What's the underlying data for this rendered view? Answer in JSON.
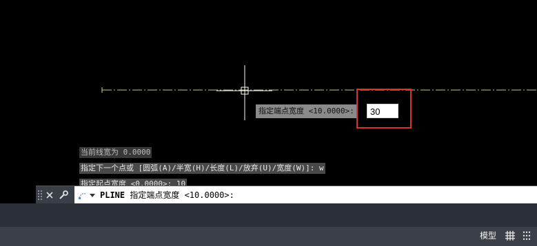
{
  "dynamic_input": {
    "prompt": "指定端点宽度 <10.0000>:",
    "value": "30"
  },
  "history": [
    "当前线宽为 0.0000",
    "指定下一个点或 [圆弧(A)/半宽(H)/长度(L)/放弃(U)/宽度(W)]: w",
    "指定起点宽度 <0.0000>: 10"
  ],
  "command_line": {
    "command": "PLINE",
    "prompt": " 指定端点宽度 <10.0000>:"
  },
  "status_bar": {
    "model_label": "模型"
  },
  "icons": {
    "close": "close-icon",
    "customize": "wrench-icon",
    "prompt": "command-prompt-icon",
    "grid": "grid-icon",
    "snap": "snap-icon"
  },
  "colors": {
    "highlight": "#d9342b",
    "line": "#c8e08a"
  }
}
